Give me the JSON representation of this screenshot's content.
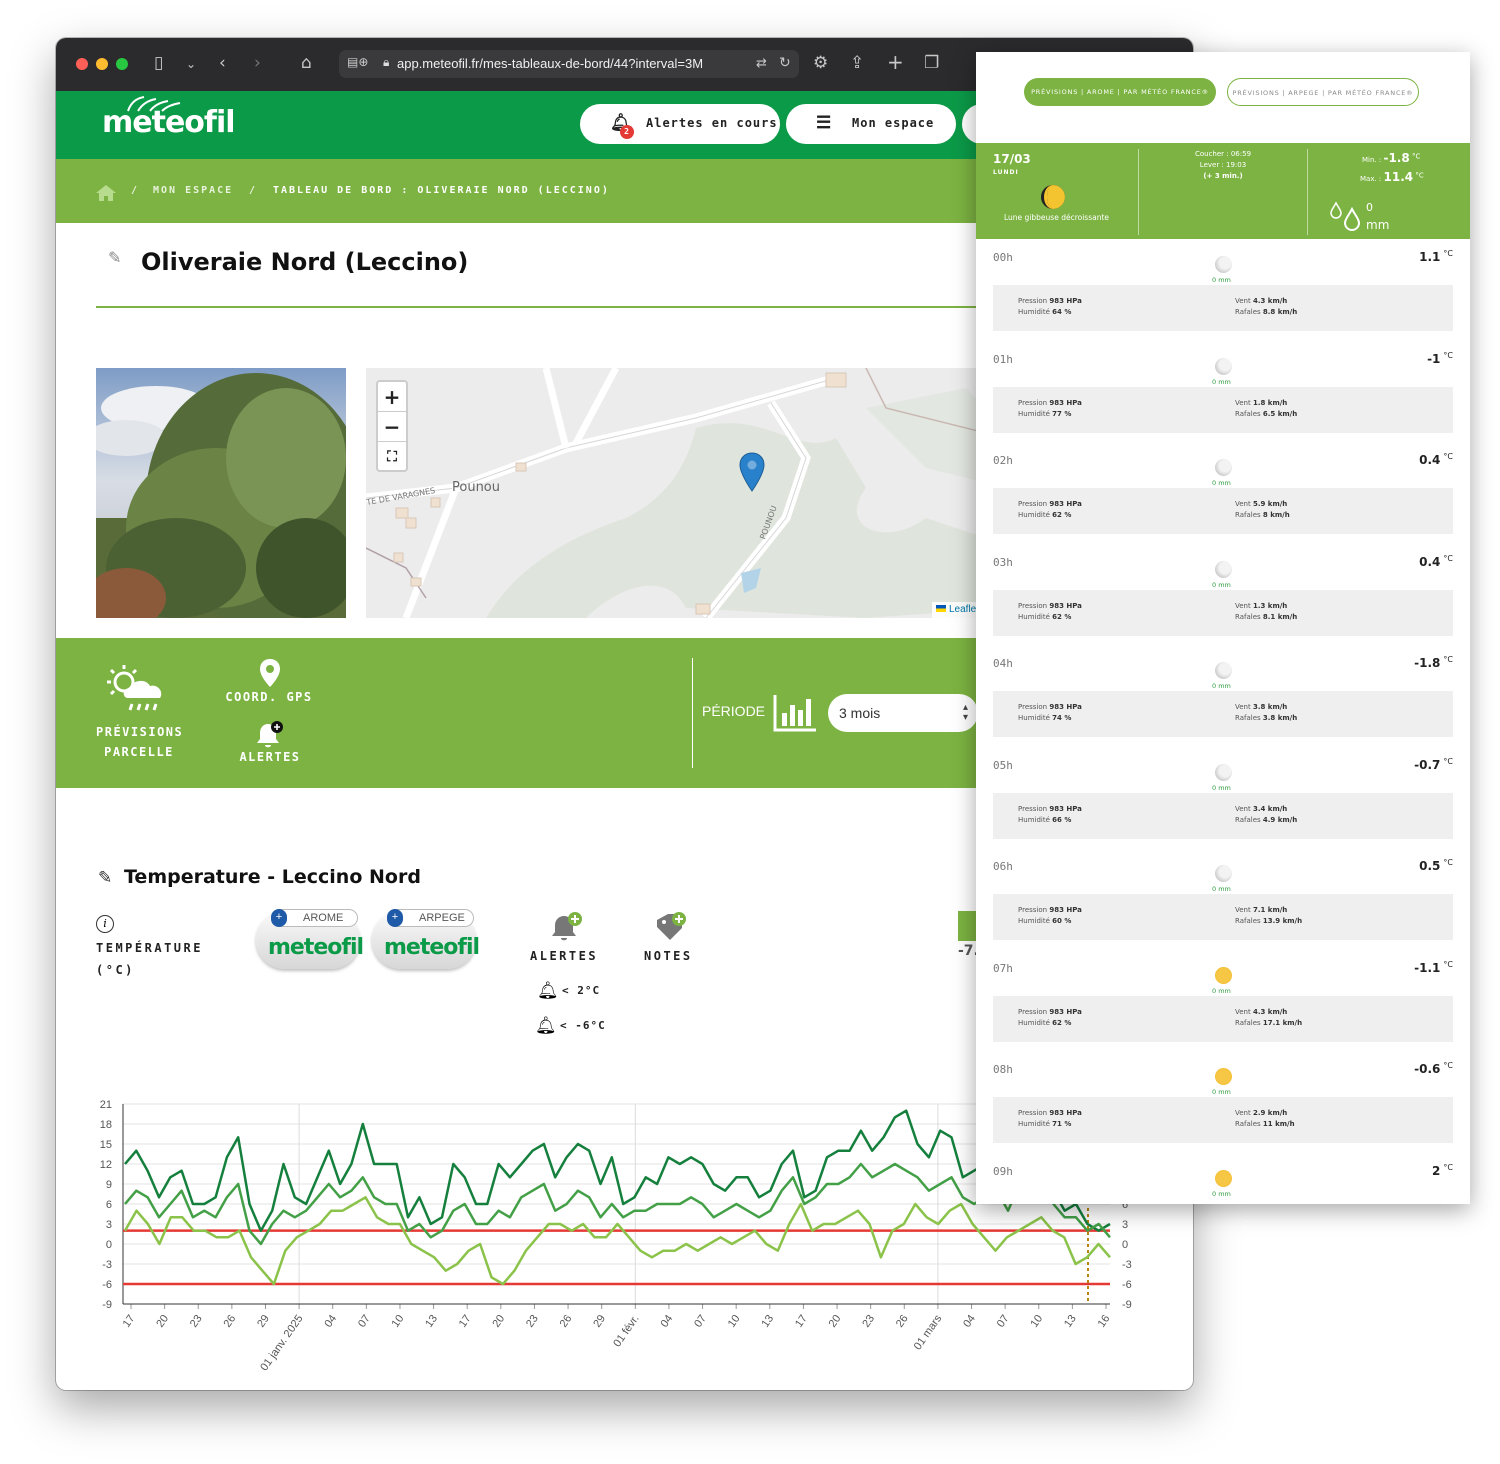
{
  "browser": {
    "url": "app.meteofil.fr/mes-tableaux-de-bord/44?interval=3M"
  },
  "header": {
    "logo": "meteofil",
    "alerts_label": "Alertes en cours",
    "alerts_badge": "2",
    "space_label": "Mon espace"
  },
  "breadcrumb": {
    "item1": "MON ESPACE",
    "sep": "/",
    "item2": "TABLEAU DE BORD : OLIVERAIE NORD (LECCINO)"
  },
  "page": {
    "title": "Oliveraie Nord (Leccino)"
  },
  "map": {
    "place": "Pounou",
    "road1": "TE DE VARAGNES",
    "road2": "POUNOU",
    "attribution": "Leaflet"
  },
  "tools": {
    "forecast_line1": "PRÉVISIONS",
    "forecast_line2": "PARCELLE",
    "gps": "COORD. GPS",
    "alerts": "ALERTES",
    "period_label": "PÉRIODE",
    "period_value": "3 mois"
  },
  "section": {
    "title": "Temperature - Leccino Nord",
    "metric_line1": "TEMPÉRATURE",
    "metric_line2": "(°C)",
    "badge1_tag": "AROME",
    "badge2_tag": "ARPEGE",
    "badge_brand": "meteofil",
    "alerts_label": "ALERTES",
    "notes_label": "NOTES",
    "alert1": "< 2°C",
    "alert2": "< -6°C",
    "clip_value": "-7."
  },
  "chart_data": {
    "type": "line",
    "ylim": [
      -9,
      21
    ],
    "yticks": [
      "21",
      "18",
      "15",
      "12",
      "9",
      "6",
      "3",
      "0",
      "-3",
      "-6",
      "-9"
    ],
    "yticks_right": [
      "6",
      "3",
      "0",
      "-3",
      "-6",
      "-9"
    ],
    "xticks": [
      "17",
      "20",
      "23",
      "26",
      "29",
      "01 janv. 2025",
      "04",
      "07",
      "10",
      "13",
      "17",
      "20",
      "23",
      "26",
      "29",
      "01 févr.",
      "04",
      "07",
      "10",
      "13",
      "17",
      "20",
      "23",
      "26",
      "01 mars",
      "04",
      "07",
      "10",
      "13",
      "16"
    ],
    "thresholds": [
      2,
      -6
    ],
    "series": [
      {
        "color": "#15803d",
        "values": [
          12,
          14,
          11,
          7,
          10,
          11,
          6,
          6,
          7,
          13,
          16,
          6,
          2,
          5,
          12,
          7,
          6,
          10,
          14,
          9,
          12,
          18,
          12,
          12,
          12,
          4,
          7,
          3,
          4,
          12,
          10,
          6,
          6,
          12,
          10,
          12,
          14,
          15,
          10,
          13,
          15,
          14,
          9,
          13,
          6,
          7,
          10,
          9,
          13,
          12,
          13,
          12,
          9,
          8,
          10,
          10,
          7,
          8,
          12,
          14,
          7,
          8,
          13,
          14,
          14,
          17,
          14,
          16,
          19,
          20,
          15,
          13,
          17,
          16,
          10,
          11,
          12,
          13,
          10,
          17,
          18,
          16,
          8,
          5,
          6,
          3,
          2,
          3
        ]
      },
      {
        "color": "#43a047",
        "values": [
          6,
          8,
          7,
          4,
          6,
          8,
          4,
          5,
          4,
          7,
          9,
          2,
          0,
          3,
          5,
          4,
          5,
          7,
          9,
          7,
          8,
          10,
          7,
          6,
          6,
          2,
          3,
          1,
          2,
          5,
          6,
          3,
          3,
          5,
          4,
          7,
          8,
          9,
          5,
          6,
          8,
          7,
          4,
          6,
          4,
          5,
          5,
          6,
          6,
          6,
          7,
          6,
          4,
          5,
          6,
          5,
          4,
          5,
          8,
          10,
          6,
          7,
          9,
          9,
          10,
          12,
          10,
          11,
          12,
          11,
          10,
          8,
          9,
          10,
          7,
          6,
          7,
          8,
          5,
          9,
          10,
          12,
          6,
          4,
          4,
          2,
          3,
          1
        ]
      },
      {
        "color": "#8bc34a",
        "values": [
          2,
          5,
          3,
          0,
          4,
          4,
          2,
          2,
          1,
          1,
          2,
          -2,
          -4,
          -6,
          -1,
          1,
          2,
          3,
          5,
          5,
          6,
          7,
          4,
          3,
          3,
          0,
          -1,
          -2,
          -4,
          -3,
          -1,
          0,
          -5,
          -6,
          -4,
          -1,
          1,
          3,
          3,
          2,
          3,
          1,
          1,
          3,
          1,
          -1,
          -2,
          -1,
          -1,
          0,
          -1,
          0,
          1,
          0,
          1,
          2,
          0,
          -1,
          3,
          6,
          2,
          3,
          3,
          4,
          5,
          3,
          -2,
          2,
          3,
          6,
          4,
          3,
          5,
          6,
          3,
          1,
          -1,
          1,
          2,
          3,
          4,
          2,
          1,
          -3,
          -2,
          0,
          -2
        ]
      }
    ]
  },
  "panel": {
    "btn_arome": "PRÉVISIONS | AROME | PAR MÉTÉO FRANCE®",
    "btn_arpege": "PRÉVISIONS | ARPEGE | PAR MÉTÉO FRANCE®",
    "date": "17/03",
    "weekday": "LUNDI",
    "moon": "Lune gibbeuse décroissante",
    "sunset": "Coucher : 06:59",
    "sunrise": "Lever : 19:03",
    "daylen": "(+ 3 min.)",
    "min_label": "Min. :",
    "min_value": "-1.8",
    "max_label": "Max. :",
    "max_value": "11.4",
    "unit": "°C",
    "rain_value": "0",
    "rain_unit": "mm",
    "hours": [
      {
        "h": "00h",
        "t": "1.1",
        "icon": "moon",
        "p": "983 HPa",
        "hum": "64 %",
        "v": "4.3 km/h",
        "r": "8.8 km/h"
      },
      {
        "h": "01h",
        "t": "-1",
        "icon": "moon",
        "p": "983 HPa",
        "hum": "77 %",
        "v": "1.8 km/h",
        "r": "6.5 km/h"
      },
      {
        "h": "02h",
        "t": "0.4",
        "icon": "moon",
        "p": "983 HPa",
        "hum": "62 %",
        "v": "5.9 km/h",
        "r": "8 km/h"
      },
      {
        "h": "03h",
        "t": "0.4",
        "icon": "moon",
        "p": "983 HPa",
        "hum": "62 %",
        "v": "1.3 km/h",
        "r": "8.1 km/h"
      },
      {
        "h": "04h",
        "t": "-1.8",
        "icon": "moon",
        "p": "983 HPa",
        "hum": "74 %",
        "v": "3.8 km/h",
        "r": "3.8 km/h"
      },
      {
        "h": "05h",
        "t": "-0.7",
        "icon": "moon",
        "p": "983 HPa",
        "hum": "66 %",
        "v": "3.4 km/h",
        "r": "4.9 km/h"
      },
      {
        "h": "06h",
        "t": "0.5",
        "icon": "moon",
        "p": "983 HPa",
        "hum": "60 %",
        "v": "7.1 km/h",
        "r": "13.9 km/h"
      },
      {
        "h": "07h",
        "t": "-1.1",
        "icon": "sun",
        "p": "983 HPa",
        "hum": "62 %",
        "v": "4.3 km/h",
        "r": "17.1 km/h"
      },
      {
        "h": "08h",
        "t": "-0.6",
        "icon": "sun",
        "p": "983 HPa",
        "hum": "71 %",
        "v": "2.9 km/h",
        "r": "11 km/h"
      },
      {
        "h": "09h",
        "t": "2",
        "icon": "sun",
        "p": "",
        "hum": "",
        "v": "",
        "r": ""
      }
    ],
    "labels": {
      "pression": "Pression",
      "humidite": "Humidité",
      "vent": "Vent",
      "rafales": "Rafales",
      "mm": "0 mm"
    }
  }
}
